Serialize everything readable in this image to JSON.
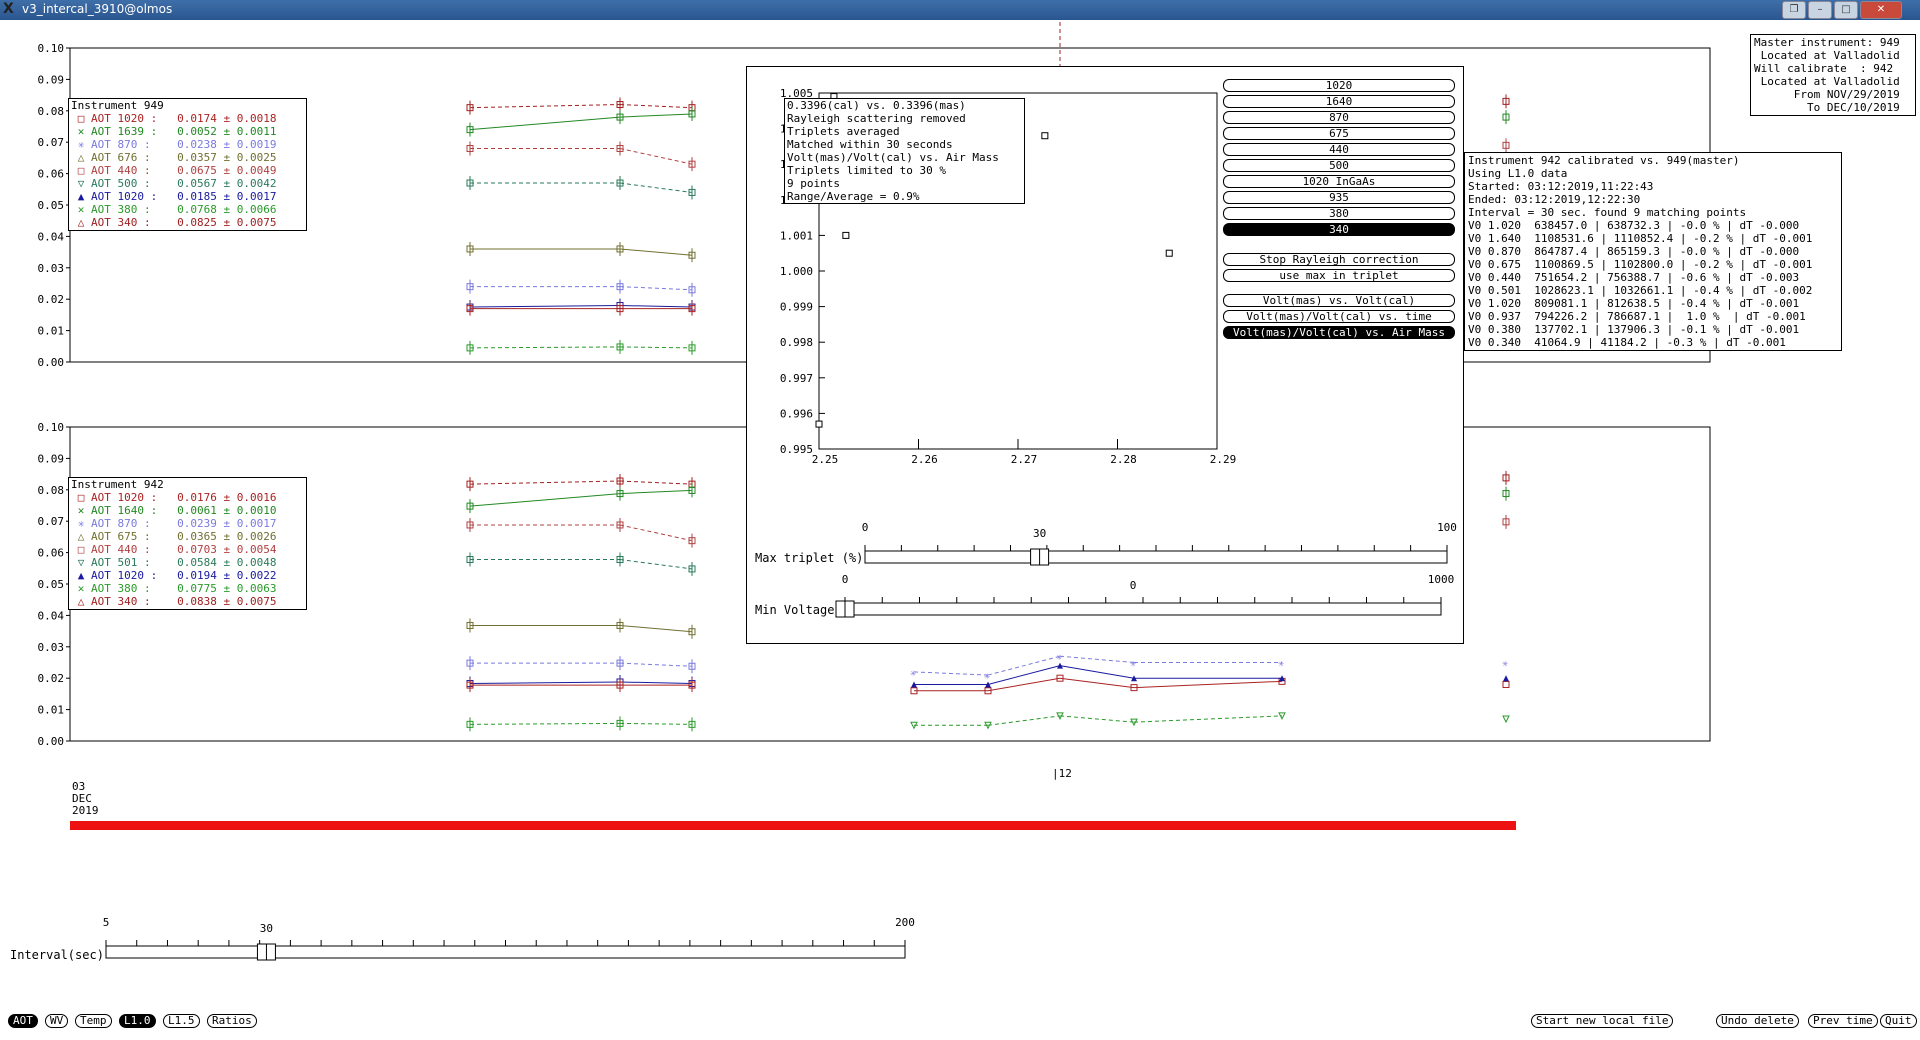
{
  "window": {
    "title": "v3_intercal_3910@olmos"
  },
  "colors": {
    "c1020": "#aa2222",
    "c1640": "#228822",
    "c870": "#7a7adf",
    "c675": "#707030",
    "c440": "#b04040",
    "c500": "#2a7a5a",
    "c1020blue": "#1a1aa0",
    "c380": "#2a9a2a",
    "c340": "#a02020",
    "timebar": "#ee1111"
  },
  "chart_data": [
    {
      "type": "scatter",
      "title": "",
      "ylim": [
        0,
        0.1
      ],
      "yticks": [
        "0.10",
        "0.09",
        "0.08",
        "0.07",
        "0.06",
        "0.05",
        "0.04",
        "0.03",
        "0.02",
        "0.01",
        "0.00"
      ]
    },
    {
      "type": "scatter",
      "title": "",
      "ylim": [
        0,
        0.1
      ],
      "yticks": [
        "0.10",
        "0.09",
        "0.08",
        "0.07",
        "0.06",
        "0.05",
        "0.04",
        "0.03",
        "0.02",
        "0.01",
        "0.00"
      ]
    },
    {
      "type": "scatter",
      "xlim": [
        2.25,
        2.29
      ],
      "ylim": [
        0.995,
        1.005
      ],
      "xticks": [
        "2.25",
        "2.26",
        "2.27",
        "2.28",
        "2.29"
      ],
      "yticks": [
        "1.005",
        "1.004",
        "1.003",
        "1.002",
        "1.001",
        "1.000",
        "0.999",
        "0.998",
        "0.997",
        "0.996",
        "0.995"
      ],
      "points": [
        [
          2.25,
          0.9957
        ],
        [
          2.2527,
          1.001
        ],
        [
          2.2727,
          1.0038
        ],
        [
          2.2852,
          1.0005
        ],
        [
          2.2515,
          1.0049
        ]
      ]
    }
  ],
  "legend_top": {
    "title": "Instrument 949",
    "rows": [
      {
        "label": "AOT 1020 :",
        "value": "0.0174 ± 0.0018",
        "mark": "□"
      },
      {
        "label": "AOT 1639 :",
        "value": "0.0052 ± 0.0011",
        "mark": "✕"
      },
      {
        "label": "AOT 870 :",
        "value": "0.0238 ± 0.0019",
        "mark": "✳"
      },
      {
        "label": "AOT 676 :",
        "value": "0.0357 ± 0.0025",
        "mark": "△"
      },
      {
        "label": "AOT 440 :",
        "value": "0.0675 ± 0.0049",
        "mark": "□"
      },
      {
        "label": "AOT 500 :",
        "value": "0.0567 ± 0.0042",
        "mark": "▽"
      },
      {
        "label": "AOT 1020 :",
        "value": "0.0185 ± 0.0017",
        "mark": "▲"
      },
      {
        "label": "AOT 380 :",
        "value": "0.0768 ± 0.0066",
        "mark": "✕"
      },
      {
        "label": "AOT 340 :",
        "value": "0.0825 ± 0.0075",
        "mark": "△"
      }
    ]
  },
  "legend_bottom": {
    "title": "Instrument 942",
    "rows": [
      {
        "label": "AOT 1020 :",
        "value": "0.0176 ± 0.0016",
        "mark": "□"
      },
      {
        "label": "AOT 1640 :",
        "value": "0.0061 ± 0.0010",
        "mark": "✕"
      },
      {
        "label": "AOT 870 :",
        "value": "0.0239 ± 0.0017",
        "mark": "✳"
      },
      {
        "label": "AOT 675 :",
        "value": "0.0365 ± 0.0026",
        "mark": "△"
      },
      {
        "label": "AOT 440 :",
        "value": "0.0703 ± 0.0054",
        "mark": "□"
      },
      {
        "label": "AOT 501 :",
        "value": "0.0584 ± 0.0048",
        "mark": "▽"
      },
      {
        "label": "AOT 1020 :",
        "value": "0.0194 ± 0.0022",
        "mark": "▲"
      },
      {
        "label": "AOT 380 :",
        "value": "0.0775 ± 0.0063",
        "mark": "✕"
      },
      {
        "label": "AOT 340 :",
        "value": "0.0838 ± 0.0075",
        "mark": "△"
      }
    ]
  },
  "master_box": "Master instrument: 949\n Located at Valladolid\nWill calibrate  : 942\n Located at Valladolid\n      From NOV/29/2019\n        To DEC/10/2019",
  "calib_box": "Instrument 942 calibrated vs. 949(master)\nUsing L1.0 data\nStarted: 03:12:2019,11:22:43\nEnded: 03:12:2019,12:22:30\nInterval = 30 sec. found 9 matching points\nV0 1.020  638457.0 | 638732.3 | -0.0 % | dT -0.000\nV0 1.640  1108531.6 | 1110852.4 | -0.2 % | dT -0.001\nV0 0.870  864787.4 | 865159.3 | -0.0 % | dT -0.000\nV0 0.675  1100869.5 | 1102800.0 | -0.2 % | dT -0.001\nV0 0.440  751654.2 | 756388.7 | -0.6 % | dT -0.003\nV0 0.501  1028623.1 | 1032661.1 | -0.4 % | dT -0.002\nV0 1.020  809081.1 | 812638.5 | -0.4 % | dT -0.001\nV0 0.937  794226.2 | 786687.1 |  1.0 %  | dT -0.001\nV0 0.380  137702.1 | 137906.3 | -0.1 % | dT -0.001\nV0 0.340  41064.9 | 41184.2 | -0.3 % | dT -0.001",
  "dialog": {
    "info": "0.3396(cal) vs. 0.3396(mas)\nRayleigh scattering removed\nTriplets averaged\nMatched within 30 seconds\nVolt(mas)/Volt(cal) vs. Air Mass\nTriplets limited to 30 %\n9 points\nRange/Average = 0.9%",
    "bands": [
      {
        "label": "1020",
        "selected": false
      },
      {
        "label": "1640",
        "selected": false
      },
      {
        "label": "870",
        "selected": false
      },
      {
        "label": "675",
        "selected": false
      },
      {
        "label": "440",
        "selected": false
      },
      {
        "label": "500",
        "selected": false
      },
      {
        "label": "1020 InGaAs",
        "selected": false
      },
      {
        "label": "935",
        "selected": false
      },
      {
        "label": "380",
        "selected": false
      },
      {
        "label": "340",
        "selected": true
      }
    ],
    "stop_rayleigh": "Stop Rayleigh correction",
    "use_max": "use max in triplet",
    "plot_modes": [
      {
        "label": "Volt(mas) vs. Volt(cal)",
        "selected": false
      },
      {
        "label": "Volt(mas)/Volt(cal) vs. time",
        "selected": false
      },
      {
        "label": "Volt(mas)/Volt(cal) vs. Air Mass",
        "selected": true
      }
    ],
    "max_triplet": {
      "label": "Max triplet (%)",
      "min": "0",
      "max": "100",
      "value": 30,
      "value_text": "30"
    },
    "min_voltage": {
      "label": "Min Voltage",
      "min": "0",
      "max": "1000",
      "value": 0,
      "value_text": "0"
    }
  },
  "time_axis": {
    "start_day": "03",
    "start_month": "DEC",
    "start_year": "2019",
    "mid_label": "12"
  },
  "interval": {
    "label": "Interval(sec)",
    "min": "5",
    "max": "200",
    "value": 30,
    "value_text": "30"
  },
  "bottom_left_buttons": [
    {
      "label": "AOT",
      "selected": true
    },
    {
      "label": "WV",
      "selected": false
    },
    {
      "label": "Temp",
      "selected": false
    },
    {
      "label": "L1.0",
      "selected": true
    },
    {
      "label": "L1.5",
      "selected": false
    },
    {
      "label": "Ratios",
      "selected": false
    }
  ],
  "bottom_right_buttons": [
    {
      "label": "Start new local file"
    },
    {
      "label": "Undo delete"
    },
    {
      "label": "Prev time"
    },
    {
      "label": "Quit"
    }
  ]
}
